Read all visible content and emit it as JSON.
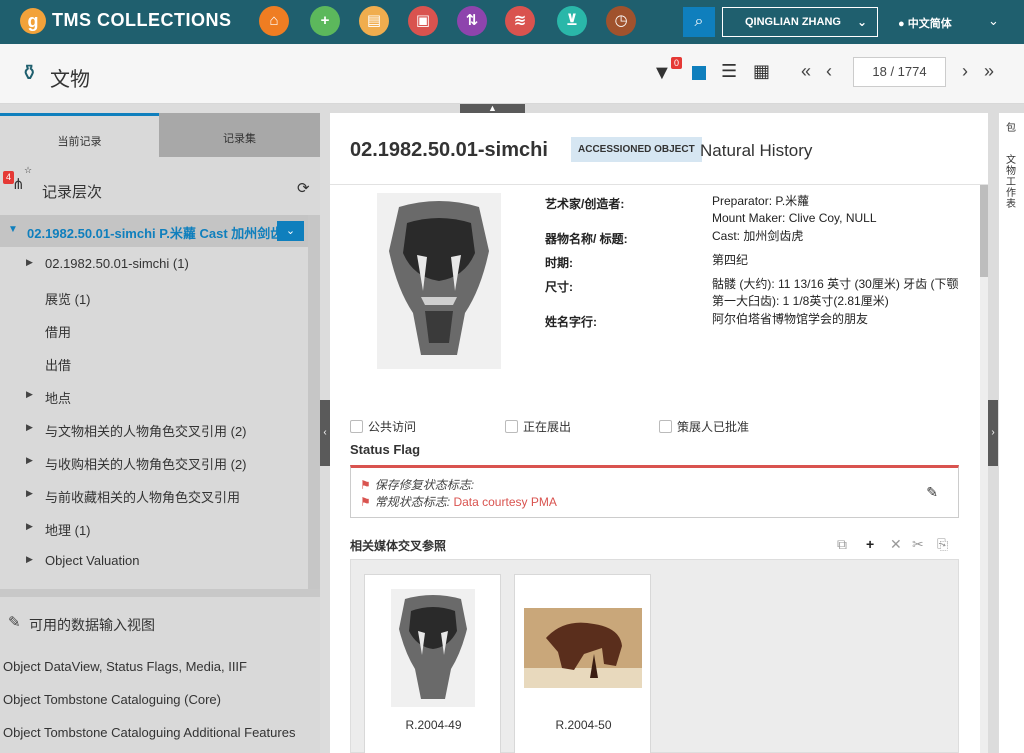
{
  "app": {
    "logo_letter": "g",
    "brand": "TMS COLLECTIONS"
  },
  "nav_buttons": [
    {
      "icon": "home-icon",
      "color": "#ef7d22"
    },
    {
      "icon": "plus-icon",
      "color": "#5cb85c"
    },
    {
      "icon": "document-icon",
      "color": "#f0ad4e"
    },
    {
      "icon": "gallery-icon",
      "color": "#d9534f"
    },
    {
      "icon": "transfer-icon",
      "color": "#8e44ad"
    },
    {
      "icon": "layers-icon",
      "color": "#d9534f"
    },
    {
      "icon": "basket-icon",
      "color": "#2ab7a9"
    },
    {
      "icon": "clock-icon",
      "color": "#a0522d"
    }
  ],
  "user": {
    "name": "QINGLIAN ZHANG"
  },
  "language": {
    "label": "中文简体"
  },
  "subbar": {
    "title": "文物",
    "filter_count": "0",
    "page": "18 / 1774"
  },
  "left": {
    "tabs": {
      "current": "当前记录",
      "recordset": "记录集"
    },
    "hierarchy": {
      "badge": "4",
      "title": "记录层次"
    },
    "selected": "02.1982.50.01-simchi P.米蘿 Cast 加州剑齿虎",
    "tree": [
      {
        "label": "02.1982.50.01-simchi (1)",
        "expandable": true
      },
      {
        "label": "展览 (1)",
        "expandable": false
      },
      {
        "label": "借用",
        "expandable": false
      },
      {
        "label": "出借",
        "expandable": false
      },
      {
        "label": "地点",
        "expandable": true
      },
      {
        "label": "与文物相关的人物角色交叉引用 (2)",
        "expandable": true
      },
      {
        "label": "与收购相关的人物角色交叉引用 (2)",
        "expandable": true
      },
      {
        "label": "与前收藏相关的人物角色交叉引用",
        "expandable": true
      },
      {
        "label": "地理 (1)",
        "expandable": true
      },
      {
        "label": "Object Valuation",
        "expandable": true
      }
    ],
    "views_title": "可用的数据输入视图",
    "views": [
      "Object DataView, Status Flags, Media, IIIF",
      "Object Tombstone Cataloguing (Core)",
      "Object Tombstone Cataloguing Additional Features"
    ]
  },
  "object": {
    "number": "02.1982.50.01-simchi",
    "status_badge": "ACCESSIONED OBJECT",
    "department": "Natural History",
    "fields": [
      {
        "label": "艺术家/创造者:",
        "value": "Preparator: P.米蘿\nMount Maker: Clive Coy, NULL"
      },
      {
        "label": "器物名称/ 标题:",
        "value": "Cast: 加州剑齿虎"
      },
      {
        "label": "时期:",
        "value": "第四纪"
      },
      {
        "label": "尺寸:",
        "value": "骷髅 (大约): 11 13/16 英寸 (30厘米) 牙齿 (下颚第一大臼齿): 1 1/8英寸(2.81厘米)"
      },
      {
        "label": "姓名字行:",
        "value": "阿尔伯塔省博物馆学会的朋友"
      }
    ],
    "checkboxes": [
      "公共访问",
      "正在展出",
      "策展人已批准"
    ],
    "status_flag": {
      "title": "Status Flag",
      "conservation": "保存修复状态标志:",
      "general_label": "常规状态标志:",
      "general_value": "Data courtesy PMA"
    },
    "media": {
      "title": "相关媒体交叉参照",
      "items": [
        {
          "caption": "R.2004-49"
        },
        {
          "caption": "R.2004-50"
        }
      ]
    }
  },
  "right_strip": [
    "包",
    "文物工作表"
  ]
}
